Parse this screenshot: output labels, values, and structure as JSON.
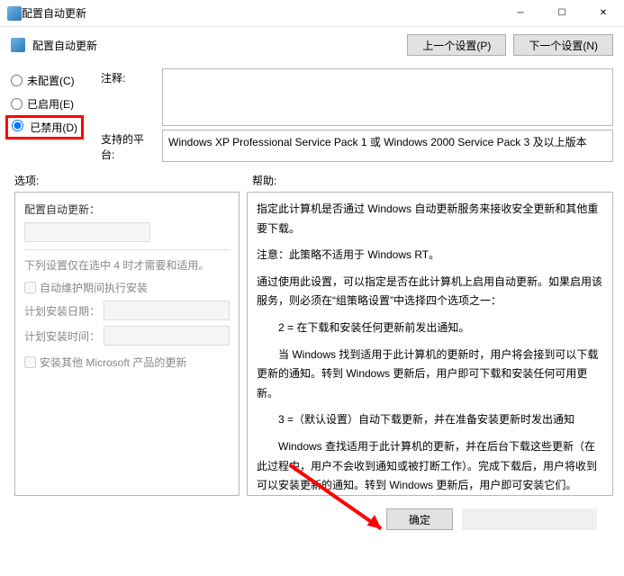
{
  "titlebar": {
    "title": "配置自动更新"
  },
  "header": {
    "subtitle": "配置自动更新",
    "prev_btn": "上一个设置(P)",
    "next_btn": "下一个设置(N)"
  },
  "radios": {
    "not_configured": "未配置(C)",
    "enabled": "已启用(E)",
    "disabled": "已禁用(D)"
  },
  "fields": {
    "comment_label": "注释:",
    "platform_label": "支持的平台:",
    "platform_text": "Windows XP Professional Service Pack 1 或 Windows 2000 Service Pack 3 及以上版本"
  },
  "section_labels": {
    "options": "选项:",
    "help": "帮助:"
  },
  "options_panel": {
    "title": "配置自动更新：",
    "note": "下列设置仅在选中 4 时才需要和适用。",
    "chk_maint": "自动维护期间执行安装",
    "sched_date": "计划安装日期：",
    "sched_time": "计划安装时间：",
    "chk_other": "安装其他 Microsoft 产品的更新"
  },
  "help_text": {
    "p1": "指定此计算机是否通过 Windows 自动更新服务来接收安全更新和其他重要下载。",
    "p2": "注意：此策略不适用于 Windows RT。",
    "p3": "通过使用此设置，可以指定是否在此计算机上启用自动更新。如果启用该服务，则必须在“组策略设置”中选择四个选项之一：",
    "p4": "　　2 = 在下载和安装任何更新前发出通知。",
    "p5": "　　当 Windows 找到适用于此计算机的更新时，用户将会接到可以下载更新的通知。转到 Windows 更新后，用户即可下载和安装任何可用更新。",
    "p6": "　　3 =（默认设置）自动下载更新，并在准备安装更新时发出通知",
    "p7": "　　Windows 查找适用于此计算机的更新，并在后台下载这些更新（在此过程中，用户不会收到通知或被打断工作）。完成下载后，用户将收到可以安装更新的通知。转到 Windows 更新后，用户即可安装它们。"
  },
  "footer": {
    "ok": "确定"
  }
}
